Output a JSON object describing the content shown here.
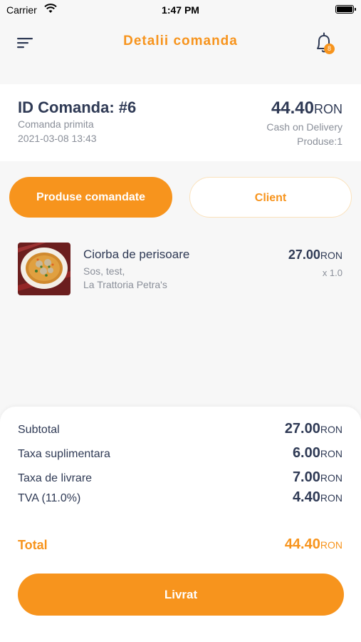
{
  "status_bar": {
    "carrier": "Carrier",
    "time": "1:47 PM"
  },
  "header": {
    "title": "Detalii comanda",
    "notification_count": "8"
  },
  "order": {
    "id_label": "ID Comanda: #6",
    "status": "Comanda primita",
    "date": "2021-03-08 13:43",
    "total_amount": "44.40",
    "currency": "RON",
    "payment_method": "Cash on Delivery",
    "products_count": "Produse:1"
  },
  "tabs": [
    {
      "label": "Produse comandate",
      "active": true
    },
    {
      "label": "Client",
      "active": false
    }
  ],
  "items": [
    {
      "name": "Ciorba de perisoare",
      "description": "Sos, test,",
      "restaurant": "La Trattoria Petra's",
      "price": "27.00",
      "currency": "RON",
      "quantity": "x 1.0"
    }
  ],
  "totals": {
    "subtotal_label": "Subtotal",
    "subtotal_value": "27.00",
    "extra_fee_label": "Taxa suplimentara",
    "extra_fee_value": "6.00",
    "delivery_label": "Taxa de livrare",
    "delivery_value": "7.00",
    "vat_label": "TVA (11.0%)",
    "vat_value": "4.40",
    "total_label": "Total",
    "total_value": "44.40",
    "currency": "RON"
  },
  "action": {
    "label": "Livrat"
  },
  "colors": {
    "accent": "#f7941d",
    "text_dark": "#2f3a55",
    "text_muted": "#8a8f99"
  },
  "icons": {
    "menu": "menu-icon",
    "notifications": "bell-icon",
    "wifi": "wifi-icon",
    "battery": "battery-icon"
  }
}
